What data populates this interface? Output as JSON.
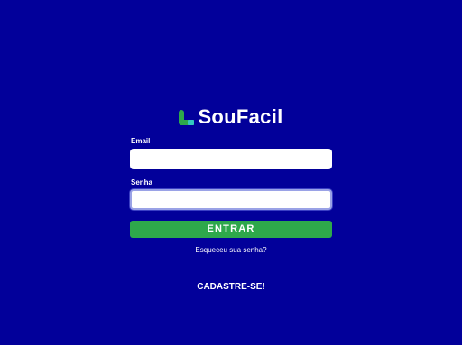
{
  "brand": {
    "name": "SouFacil",
    "icon": "soufacil-logo-icon",
    "icon_colors": [
      "#2ea84b",
      "#33c7c0"
    ]
  },
  "colors": {
    "background": "#02009a",
    "primary_button": "#2ea84b",
    "text": "#ffffff"
  },
  "login_form": {
    "email_label": "Email",
    "email_value": "",
    "password_label": "Senha",
    "password_value": "",
    "submit_label": "ENTRAR",
    "forgot_password_link": "Esqueceu sua senha?"
  },
  "signup": {
    "label": "CADASTRE-SE!"
  }
}
